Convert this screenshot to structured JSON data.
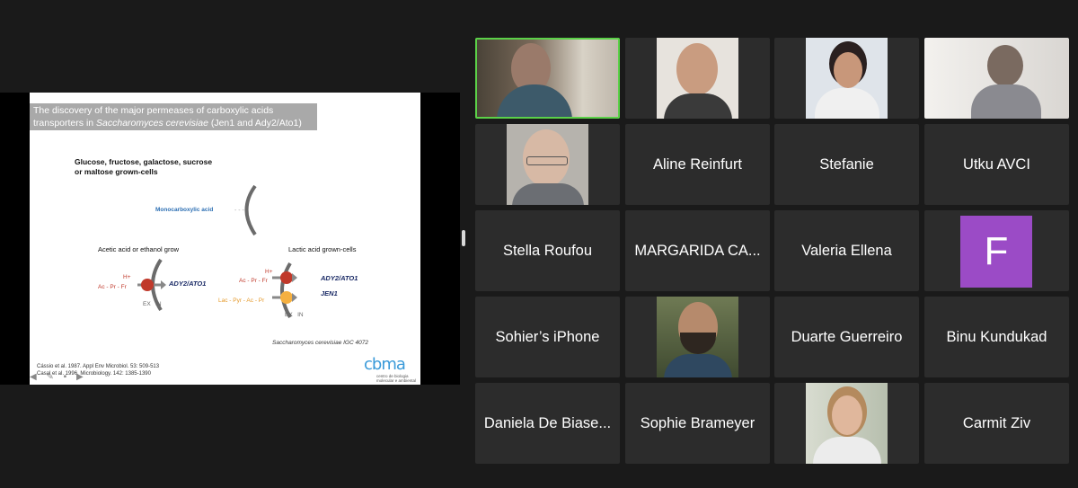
{
  "slide": {
    "title_line1": "The discovery of  the major permeases of carboxylic acids",
    "title_line2_pre": "transporters in ",
    "title_line2_italic": "Saccharomyces cerevisiae",
    "title_line2_post": " (Jen1 and Ady2/Ato1)",
    "grown_line1": "Glucose, fructose, galactose, sucrose",
    "grown_line2": "or maltose grown-cells",
    "mono_label": "Monocarboxylic acid",
    "acetic_label": "Acetic acid or ethanol grow",
    "lactic_label": "Lactic acid grown-cells",
    "h_plus": "H+",
    "left_acids": "Ac - Pr - Fr",
    "mid_acids": "Ac - Pr - Fr",
    "lac_acids": "Lac - Pyr - Ac - Pr",
    "ady_label": "ADY2/ATO1",
    "ady_label2": "ADY2/ATO1",
    "jen_label": "JEN1",
    "ex": "EX",
    "in": "IN",
    "species": "Saccharomyces cerevisiae IGC 4072",
    "ref1": "Cássio et al. 1987. Appl Env Microbiol. 53: 509-513",
    "ref2": "Casal et al. 1996. Microbiology. 142: 1385-1390",
    "logo": "cbma",
    "logo_sub1": "centro de biologia",
    "logo_sub2": "molecular e ambiental"
  },
  "participants": [
    {
      "name": "",
      "video": true,
      "active": true
    },
    {
      "name": "",
      "video": true
    },
    {
      "name": "",
      "video": true
    },
    {
      "name": "",
      "video": true
    },
    {
      "name": "",
      "video": true
    },
    {
      "name": "Aline Reinfurt"
    },
    {
      "name": "Stefanie"
    },
    {
      "name": "Utku AVCI"
    },
    {
      "name": "Stella Roufou"
    },
    {
      "name": "MARGARIDA CA..."
    },
    {
      "name": "Valeria Ellena"
    },
    {
      "name": "",
      "avatar_letter": "F"
    },
    {
      "name": "Sohier’s iPhone"
    },
    {
      "name": "",
      "video": true
    },
    {
      "name": "Duarte Guerreiro"
    },
    {
      "name": "Binu Kundukad"
    },
    {
      "name": "Daniela De Biase..."
    },
    {
      "name": "Sophie Brameyer"
    },
    {
      "name": "",
      "video": true
    },
    {
      "name": "Carmit Ziv"
    }
  ],
  "colors": {
    "active_border": "#5bd148",
    "avatar_bg": "#9b4bc6",
    "tile_bg": "#2c2c2c"
  }
}
